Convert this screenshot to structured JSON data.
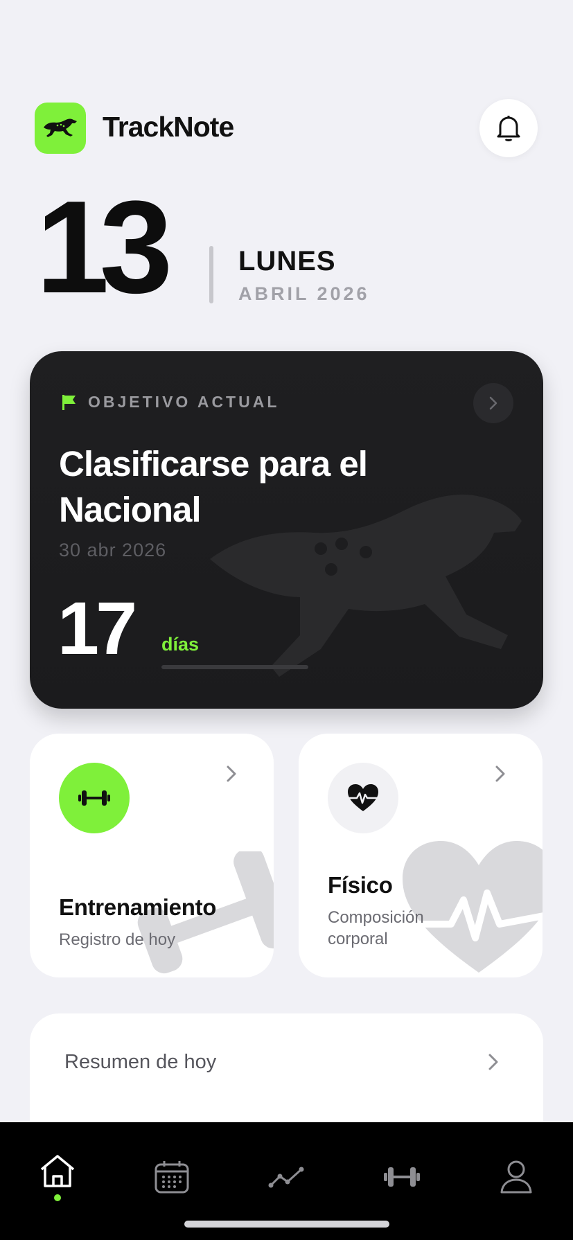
{
  "header": {
    "app_name": "TrackNote",
    "logo_icon": "cheetah-icon",
    "bell_icon": "bell-icon"
  },
  "date": {
    "day": "13",
    "weekday": "LUNES",
    "month_year": "ABRIL 2026"
  },
  "goal_card": {
    "label": "OBJETIVO ACTUAL",
    "title": "Clasificarse para el Nacional",
    "target_date": "30 abr 2026",
    "days_remaining": "17",
    "days_unit": "días",
    "progress_fraction": 0
  },
  "tiles": {
    "training": {
      "title": "Entrenamiento",
      "subtitle": "Registro de hoy",
      "icon": "dumbbell-icon"
    },
    "physical": {
      "title": "Físico",
      "subtitle": "Composición corporal",
      "icon": "heart-pulse-icon"
    }
  },
  "summary": {
    "title": "Resumen de hoy"
  },
  "tab_bar": {
    "tabs": [
      "home-icon",
      "calendar-icon",
      "stats-icon",
      "dumbbell-icon",
      "profile-icon"
    ],
    "active": "home"
  },
  "colors": {
    "accent": "#7ff03a",
    "background": "#f1f1f6",
    "card_dark": "#1f1f21",
    "tab_bar": "#000000"
  }
}
